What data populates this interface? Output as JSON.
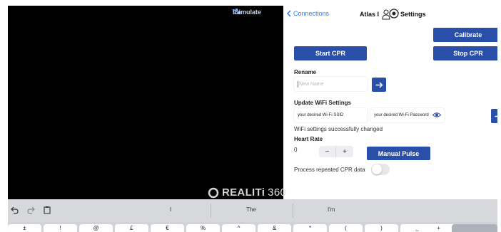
{
  "video": {
    "brand": "iSimulate",
    "watermark_brand": "REALITi",
    "watermark_suffix": "360"
  },
  "nav": {
    "back_label": "Connections",
    "title_prefix": "Atlas I",
    "title_suffix": "Settings"
  },
  "buttons": {
    "calibrate": "Calibrate",
    "start_cpr": "Start CPR",
    "stop_cpr": "Stop CPR",
    "manual_pulse": "Manual Pulse"
  },
  "rename": {
    "heading": "Rename",
    "placeholder": "New Name"
  },
  "wifi": {
    "heading": "Update WiFi Settings",
    "ssid_value": "your desired Wi-Fi SSID",
    "password_value": "your desired Wi-Fi Password",
    "status": "WiFi settings successfully changed"
  },
  "heart_rate": {
    "heading": "Heart Rate",
    "value": "0",
    "minus": "−",
    "plus": "+"
  },
  "process_cpr": {
    "label": "Process repeated CPR data",
    "enabled": false
  },
  "keyboard": {
    "suggestions": [
      "I",
      "The",
      "I'm"
    ],
    "keys": [
      "±",
      "!",
      "@",
      "£",
      "€",
      "%",
      "^",
      "&",
      "*",
      "(",
      ")",
      "_",
      "+",
      ""
    ]
  },
  "colors": {
    "accent": "#2a4fa8",
    "link": "#2d7df6",
    "video_bg": "#000000"
  }
}
